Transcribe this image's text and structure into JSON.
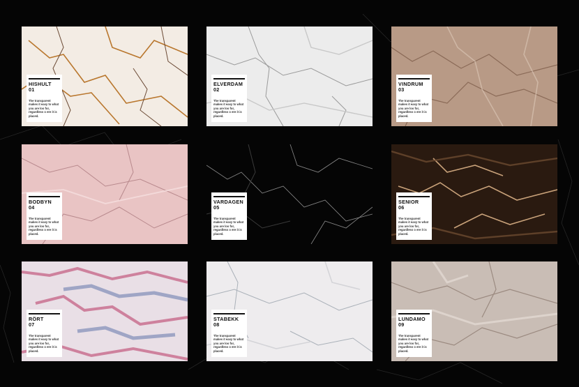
{
  "swatches": [
    {
      "name": "HISHULT",
      "number": "01",
      "description": "The transparent makes it easy to what you are loo for, regardless o ere it is placed.",
      "base": "#f3ece4",
      "vein": "#b9772e",
      "vein2": "#6b4a35"
    },
    {
      "name": "ELVERDAM",
      "number": "02",
      "description": "The transparent makes it easy to what you are loo for, regardless o ere it is placed.",
      "base": "#ececec",
      "vein": "#9a9a9a",
      "vein2": "#c8c8c8"
    },
    {
      "name": "VINDRUM",
      "number": "03",
      "description": "The transparent makes it easy to what you are loo for, regardless o ere it is placed.",
      "base": "#b89a86",
      "vein": "#8a6a57",
      "vein2": "#d8c3b2"
    },
    {
      "name": "BODBYN",
      "number": "04",
      "description": "The transparent makes it easy to what you are loo for, regardless o ere it is placed.",
      "base": "#e9c4c4",
      "vein": "#b8898d",
      "vein2": "#f5dede"
    },
    {
      "name": "VARDAGEN",
      "number": "05",
      "description": "The transparent makes it easy to what you are loo for, regardless o ere it is placed.",
      "base": "#050505",
      "vein": "#8a8a8a",
      "vein2": "#3a3a3a"
    },
    {
      "name": "SENIOR",
      "number": "06",
      "description": "The transparent makes it easy to what you are loo for, regardless o ere it is placed.",
      "base": "#2a1a10",
      "vein": "#c9a27a",
      "vein2": "#6b4a30"
    },
    {
      "name": "RÖRT",
      "number": "07",
      "description": "The transparent makes it easy to what you are loo for, regardless o ere it is placed.",
      "base": "#e9dfe6",
      "vein": "#c35a7f",
      "vein2": "#6e7fb0"
    },
    {
      "name": "STABEKK",
      "number": "08",
      "description": "The transparent makes it easy to what you are loo for, regardless o ere it is placed.",
      "base": "#eeecee",
      "vein": "#a9b0b8",
      "vein2": "#d4d4d8"
    },
    {
      "name": "LUNDAMO",
      "number": "09",
      "description": "The transparent makes it easy to what you are loo for, regardless o ere it is placed.",
      "base": "#c9bdb5",
      "vein": "#9b8a80",
      "vein2": "#e6ddd6"
    }
  ],
  "colors": {
    "background": "#050505",
    "card": "#ffffff",
    "card_text": "#111111"
  }
}
